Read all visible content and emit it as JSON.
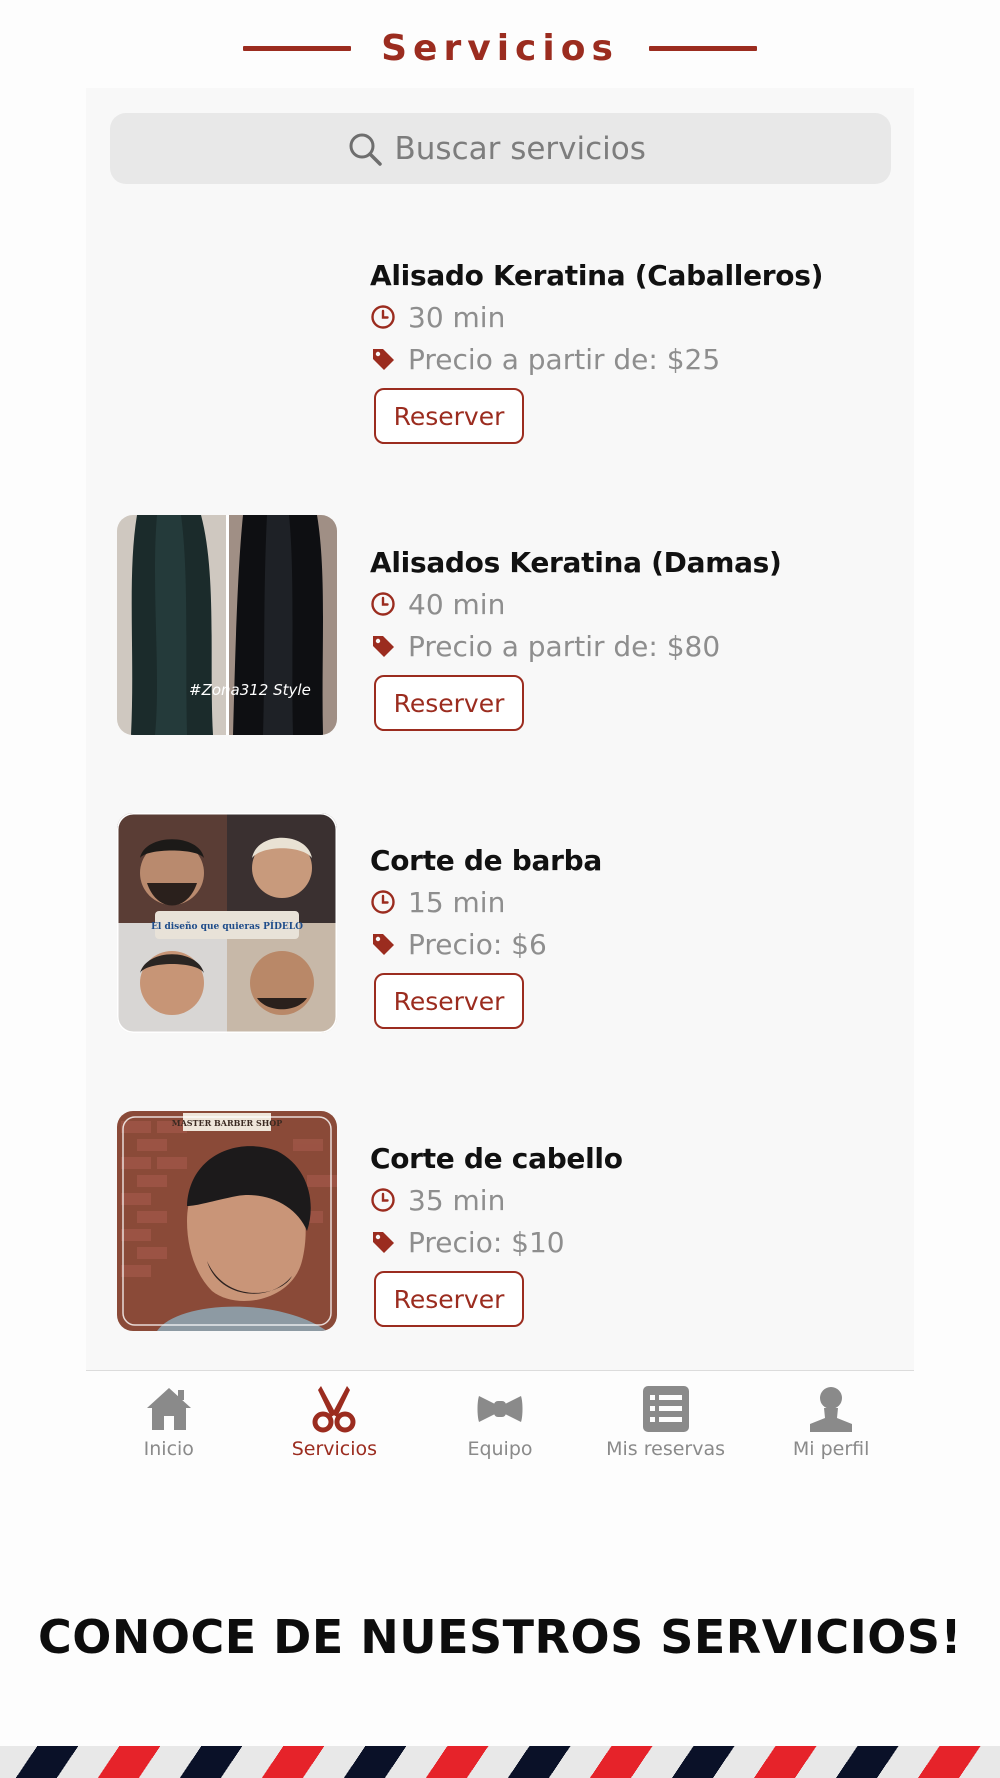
{
  "header": {
    "title": "Servicios"
  },
  "search": {
    "placeholder": "Buscar servicios"
  },
  "services": [
    {
      "name": "Alisado Keratina (Caballeros)",
      "duration": "30 min",
      "price": "Precio a partir de: $25",
      "button": "Reserver",
      "image": "none"
    },
    {
      "name": "Alisados Keratina (Damas)",
      "duration": "40 min",
      "price": "Precio a partir de: $80",
      "button": "Reserver",
      "image": "long-straightened-hair-photo",
      "image_text": "#Zona312 Style"
    },
    {
      "name": "Corte de barba",
      "duration": "15 min",
      "price": "Precio: $6",
      "button": "Reserver",
      "image": "beard-collage-photo",
      "image_text": "El diseño que quieras PÍDELO"
    },
    {
      "name": "Corte de cabello",
      "duration": "35 min",
      "price": "Precio: $10",
      "button": "Reserver",
      "image": "haircut-profile-photo",
      "image_text": "MASTER BARBER SHOP"
    }
  ],
  "tabs": [
    {
      "label": "Inicio",
      "icon": "home-icon",
      "active": false
    },
    {
      "label": "Servicios",
      "icon": "scissors-icon",
      "active": true
    },
    {
      "label": "Equipo",
      "icon": "bowtie-icon",
      "active": false
    },
    {
      "label": "Mis reservas",
      "icon": "list-icon",
      "active": false
    },
    {
      "label": "Mi perfil",
      "icon": "user-icon",
      "active": false
    }
  ],
  "banner": {
    "text": "CONOCE DE NUESTROS SERVICIOS!"
  },
  "colors": {
    "accent": "#9b2c1f",
    "muted": "#8e8e8e",
    "panel": "#f8f8f8",
    "stripe_red": "#e6232a",
    "stripe_navy": "#0a1128"
  }
}
